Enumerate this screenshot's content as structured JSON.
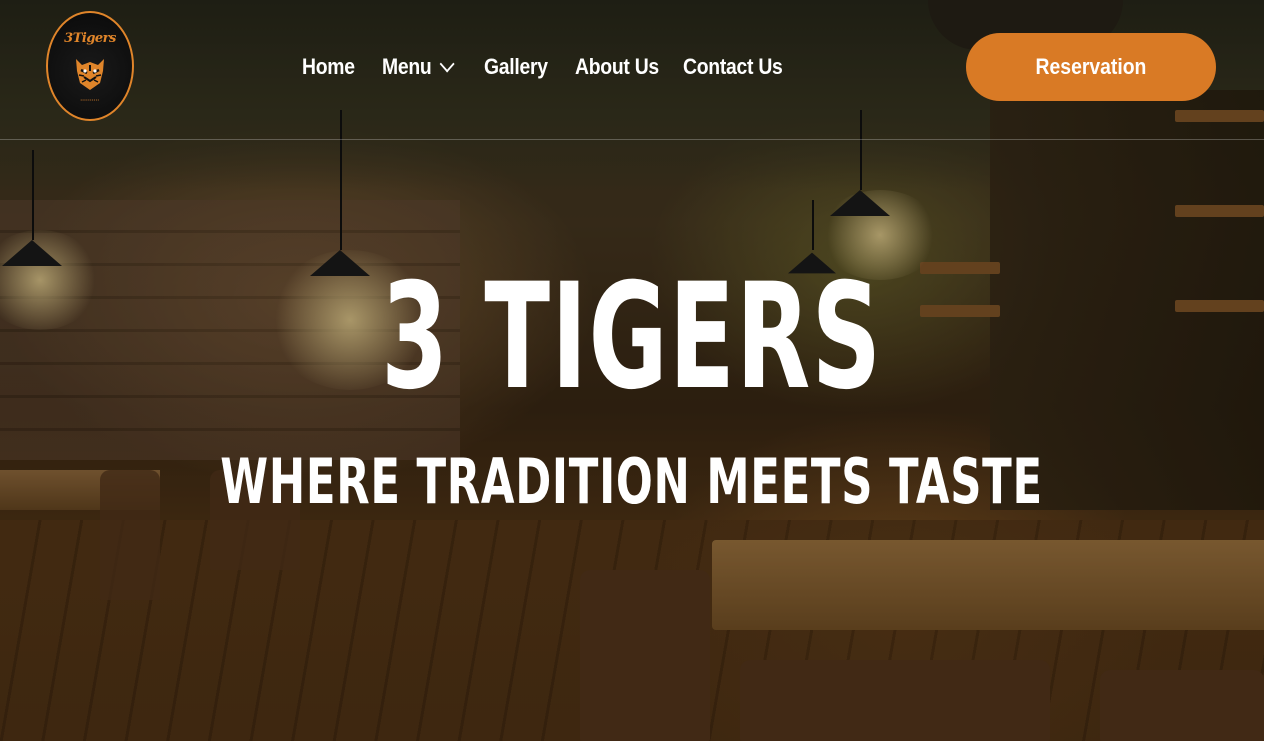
{
  "brand": {
    "logo_text": "3Tigers",
    "logo_alt": "3 Tigers logo"
  },
  "nav": {
    "items": [
      {
        "label": "Home"
      },
      {
        "label": "Menu",
        "has_dropdown": true
      },
      {
        "label": "Gallery"
      },
      {
        "label": "About Us"
      },
      {
        "label": "Contact Us"
      }
    ],
    "cta_label": "Reservation"
  },
  "hero": {
    "title": "3 TIGERS",
    "subtitle": "WHERE TRADITION MEETS TASTE"
  },
  "colors": {
    "accent": "#d97a25",
    "text": "#ffffff"
  }
}
